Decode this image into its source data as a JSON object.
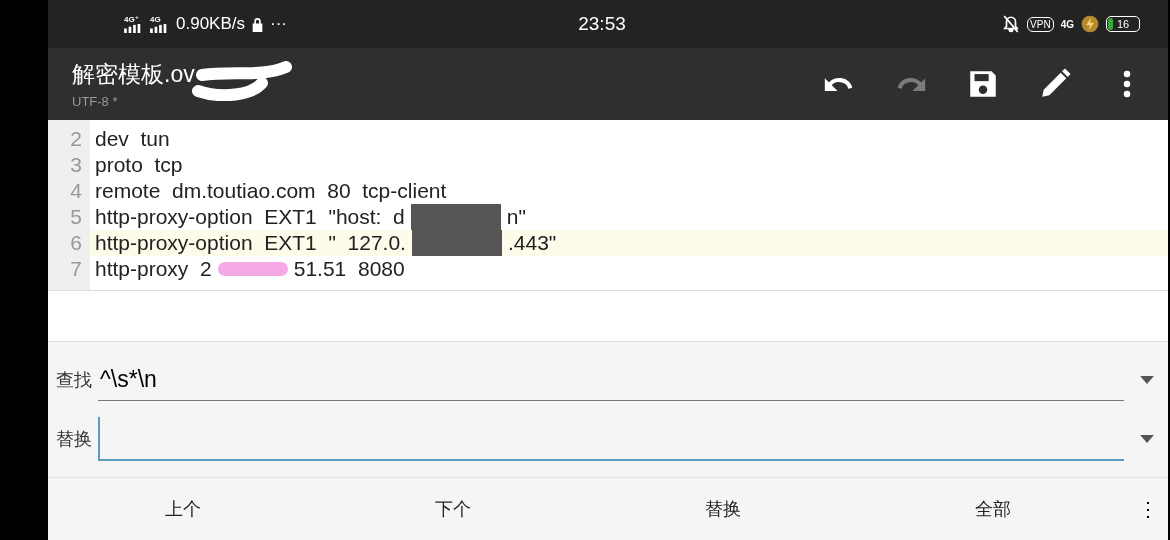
{
  "status_bar": {
    "network": "4G⁺",
    "network_2": "4G",
    "speed": "0.90KB/s",
    "more": "···",
    "time": "23:53",
    "vpn": "VPN",
    "data": "4G",
    "battery": "16"
  },
  "toolbar": {
    "title": "解密模板.ov",
    "subtitle": "UTF-8 *",
    "actions": [
      {
        "kind": "undo",
        "disabled": false
      },
      {
        "kind": "redo",
        "disabled": true
      },
      {
        "kind": "save",
        "disabled": false
      },
      {
        "kind": "edit",
        "disabled": false
      },
      {
        "kind": "more",
        "disabled": false
      }
    ]
  },
  "editor": {
    "lines": [
      {
        "number": "2",
        "text": "dev  tun",
        "selected": false
      },
      {
        "number": "3",
        "text": "proto  tcp",
        "selected": false
      },
      {
        "number": "4",
        "text": "remote  dm.toutiao.com  80  tcp-client",
        "selected": false
      },
      {
        "number": "5",
        "text": "http-proxy-option  EXT1  \"host:  d",
        "tail": "n\"",
        "selected": false
      },
      {
        "number": "6",
        "text": "http-proxy-option  EXT1  \"  127.0.",
        "tail": ".443\"",
        "selected": true
      },
      {
        "number": "7",
        "text": "http-proxy  2",
        "tail": "51.51  8080",
        "selected": false
      }
    ]
  },
  "find_panel": {
    "find": {
      "label": "查找",
      "value": "^\\s*\\n",
      "focused": false
    },
    "replace": {
      "label": "替换",
      "focused": true
    },
    "buttons": [
      "上个",
      "下个",
      "替换",
      "全部"
    ],
    "more": "⋮"
  }
}
